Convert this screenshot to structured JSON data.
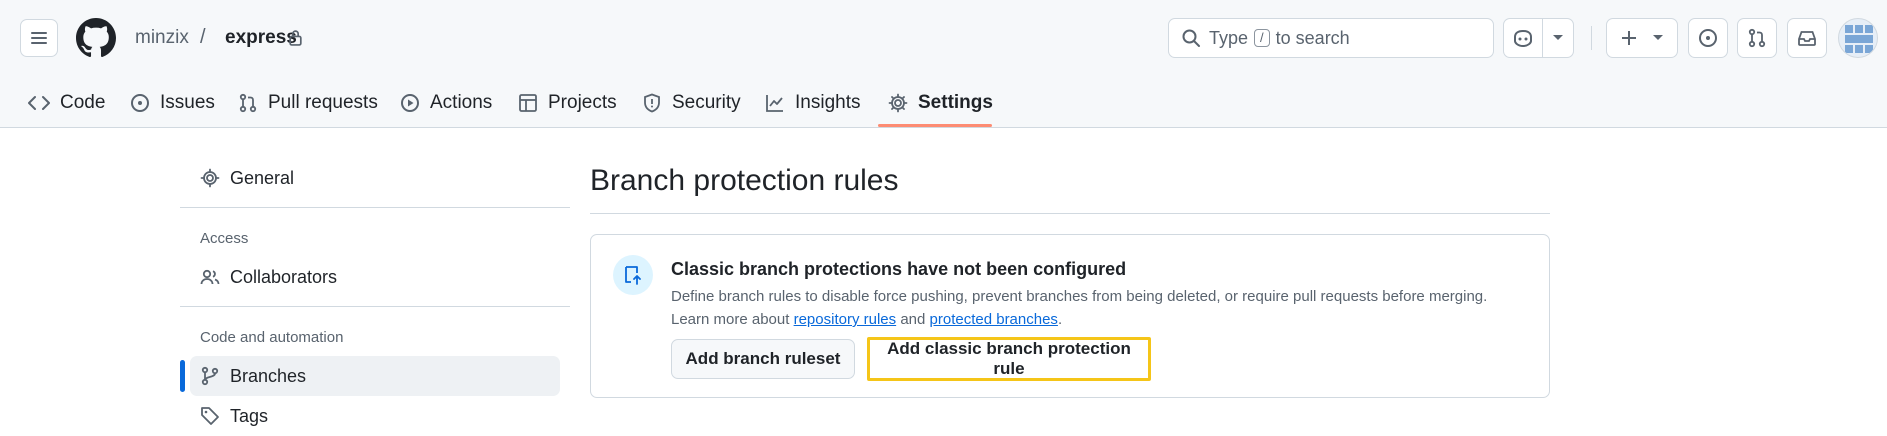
{
  "header": {
    "owner": "minzix",
    "separator": "/",
    "repo": "express",
    "search": {
      "text_before": "Type",
      "kbd": "/",
      "text_after": "to search"
    }
  },
  "tabs": [
    {
      "label": "Code",
      "icon": "code-icon"
    },
    {
      "label": "Issues",
      "icon": "issue-opened-icon"
    },
    {
      "label": "Pull requests",
      "icon": "git-pull-request-icon"
    },
    {
      "label": "Actions",
      "icon": "play-icon"
    },
    {
      "label": "Projects",
      "icon": "table-icon"
    },
    {
      "label": "Security",
      "icon": "shield-icon"
    },
    {
      "label": "Insights",
      "icon": "graph-icon"
    },
    {
      "label": "Settings",
      "icon": "gear-icon",
      "selected": true
    }
  ],
  "sidebar": {
    "general": "General",
    "access_heading": "Access",
    "collaborators": "Collaborators",
    "code_heading": "Code and automation",
    "branches": "Branches",
    "tags": "Tags"
  },
  "main": {
    "title": "Branch protection rules",
    "card": {
      "heading": "Classic branch protections have not been configured",
      "desc_line1": "Define branch rules to disable force pushing, prevent branches from being deleted, or require pull requests before merging.",
      "desc_prefix": "Learn more about",
      "link_repository_rules": "repository rules",
      "desc_and": "and",
      "link_protected_branches": "protected branches",
      "desc_suffix": ".",
      "btn_ruleset": "Add branch ruleset",
      "btn_classic": "Add classic branch protection rule"
    }
  },
  "colors": {
    "accent": "#0969da",
    "tab_underline": "#fd8c73",
    "highlight": "#f5c518"
  }
}
